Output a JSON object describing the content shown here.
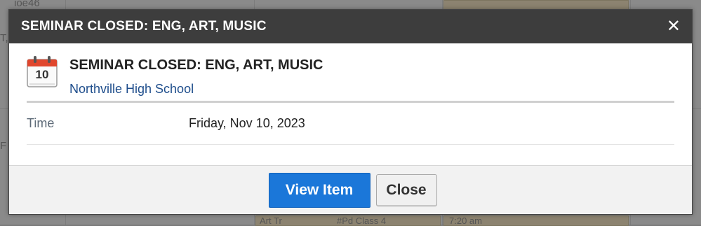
{
  "modal": {
    "header_title": "SEMINAR CLOSED: ENG, ART, MUSIC",
    "close_glyph": "✕",
    "event": {
      "icon": "calendar-icon",
      "icon_day": "10",
      "title": "SEMINAR CLOSED: ENG, ART, MUSIC",
      "school": "Northville High School"
    },
    "details": [
      {
        "label": "Time",
        "value": "Friday, Nov 10, 2023"
      }
    ],
    "buttons": {
      "view_item": "View Item",
      "close": "Close"
    }
  },
  "background": {
    "fragments": [
      "ioe46",
      "T,",
      "F",
      "7:20 am",
      "Art Tr",
      "#Pd Class 4"
    ]
  },
  "colors": {
    "header_bg": "#3d3d3d",
    "primary_button": "#1b77d9",
    "link": "#1f4e8c"
  }
}
